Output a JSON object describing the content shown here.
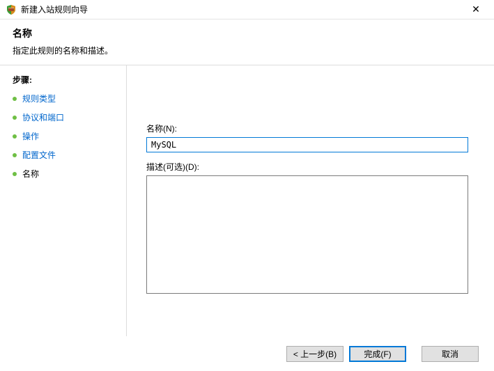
{
  "titlebar": {
    "title": "新建入站规则向导",
    "close_glyph": "✕"
  },
  "header": {
    "title": "名称",
    "subtitle": "指定此规则的名称和描述。"
  },
  "sidebar": {
    "steps_label": "步骤:",
    "items": [
      {
        "label": "规则类型",
        "current": false
      },
      {
        "label": "协议和端口",
        "current": false
      },
      {
        "label": "操作",
        "current": false
      },
      {
        "label": "配置文件",
        "current": false
      },
      {
        "label": "名称",
        "current": true
      }
    ]
  },
  "main": {
    "name_label": "名称(N):",
    "name_value": "MySQL",
    "desc_label": "描述(可选)(D):",
    "desc_value": ""
  },
  "footer": {
    "back_label": "< 上一步(B)",
    "finish_label": "完成(F)",
    "cancel_label": "取消"
  }
}
